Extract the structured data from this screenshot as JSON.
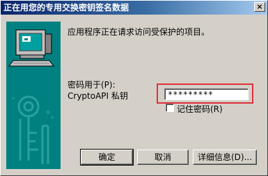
{
  "window": {
    "title": "正在用您的专用交换密钥签名数据",
    "close_glyph": "×"
  },
  "message": "应用程序正在请求访问受保护的项目。",
  "password_label": "密码用于(P):",
  "key_name": "CryptoAPI 私钥",
  "password_value": "*********",
  "remember_label": "记住密码(R)",
  "buttons": {
    "ok": "确定",
    "cancel": "取消",
    "details": "详细信息(D)..."
  },
  "colors": {
    "highlight": "#e0303a",
    "titlebar": "#0a246a",
    "dialog_bg": "#d4d0c8"
  }
}
